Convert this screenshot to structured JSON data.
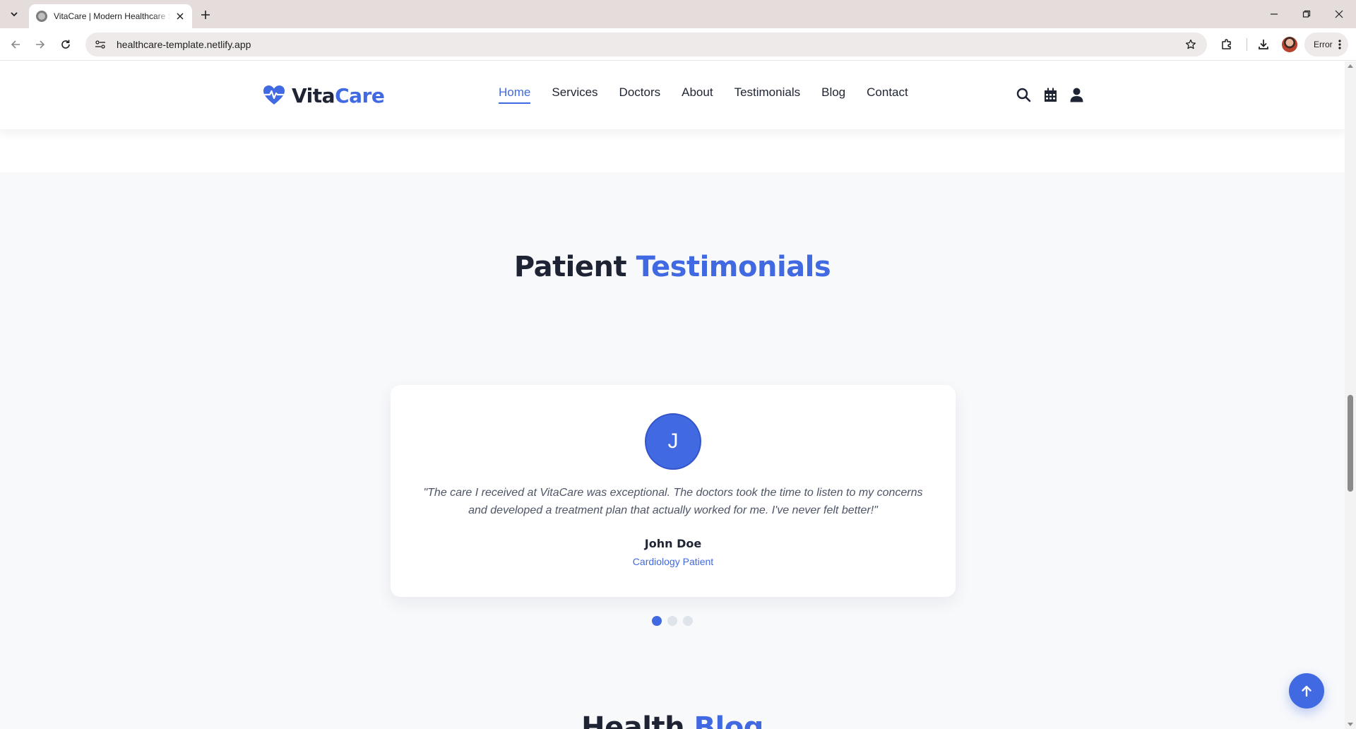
{
  "browser": {
    "tab_title": "VitaCare | Modern Healthcare Services",
    "url": "healthcare-template.netlify.app",
    "profile_label": "Error"
  },
  "header": {
    "logo": {
      "part1": "Vita",
      "part2": "Care",
      "icon": "heart-pulse-icon"
    },
    "nav": [
      "Home",
      "Services",
      "Doctors",
      "About",
      "Testimonials",
      "Blog",
      "Contact"
    ],
    "active_nav": "Home",
    "icons": [
      "search-icon",
      "calendar-icon",
      "user-icon"
    ]
  },
  "testimonials": {
    "title_main": "Patient",
    "title_accent": "Testimonials",
    "items": [
      {
        "initial": "J",
        "quote": "\"The care I received at VitaCare was exceptional. The doctors took the time to listen to my concerns and developed a treatment plan that actually worked for me. I've never felt better!\"",
        "name": "John Doe",
        "role": "Cardiology Patient"
      }
    ],
    "dots_count": 3,
    "active_dot": 0
  },
  "blog": {
    "title_main": "Health",
    "title_accent": "Blog"
  },
  "colors": {
    "accent": "#4169e1",
    "dark": "#1e2433",
    "section_bg": "#f8f9fb"
  }
}
